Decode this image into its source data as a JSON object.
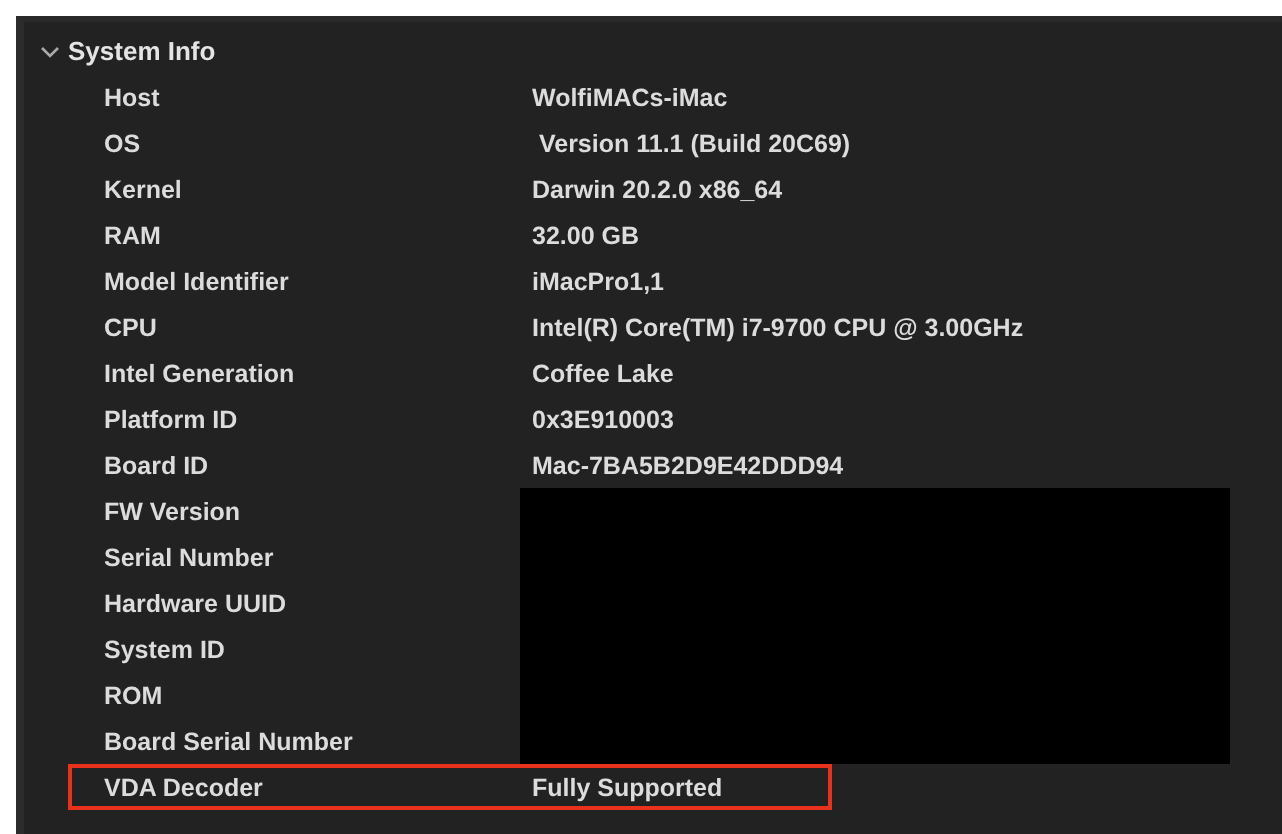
{
  "section": {
    "title": "System Info",
    "expanded": true
  },
  "rows": [
    {
      "label": "Host",
      "value": "WolfiMACs-iMac",
      "redacted": false,
      "highlighted": false
    },
    {
      "label": "OS",
      "value": " Version 11.1 (Build 20C69)",
      "redacted": false,
      "highlighted": false
    },
    {
      "label": "Kernel",
      "value": "Darwin 20.2.0 x86_64",
      "redacted": false,
      "highlighted": false
    },
    {
      "label": "RAM",
      "value": "32.00 GB",
      "redacted": false,
      "highlighted": false
    },
    {
      "label": "Model Identifier",
      "value": "iMacPro1,1",
      "redacted": false,
      "highlighted": false
    },
    {
      "label": "CPU",
      "value": "Intel(R) Core(TM) i7-9700 CPU @ 3.00GHz",
      "redacted": false,
      "highlighted": false
    },
    {
      "label": "Intel Generation",
      "value": "Coffee Lake",
      "redacted": false,
      "highlighted": false
    },
    {
      "label": "Platform ID",
      "value": "0x3E910003",
      "redacted": false,
      "highlighted": false
    },
    {
      "label": "Board ID",
      "value": "Mac-7BA5B2D9E42DDD94",
      "redacted": false,
      "highlighted": false
    },
    {
      "label": "FW Version",
      "redacted": true,
      "highlighted": false
    },
    {
      "label": "Serial Number",
      "redacted": true,
      "highlighted": false
    },
    {
      "label": "Hardware UUID",
      "redacted": true,
      "highlighted": false
    },
    {
      "label": "System ID",
      "redacted": true,
      "highlighted": false
    },
    {
      "label": "ROM",
      "redacted": true,
      "highlighted": false
    },
    {
      "label": "Board Serial Number",
      "redacted": true,
      "highlighted": false
    },
    {
      "label": "VDA Decoder",
      "value": "Fully Supported",
      "redacted": false,
      "highlighted": true
    }
  ]
}
